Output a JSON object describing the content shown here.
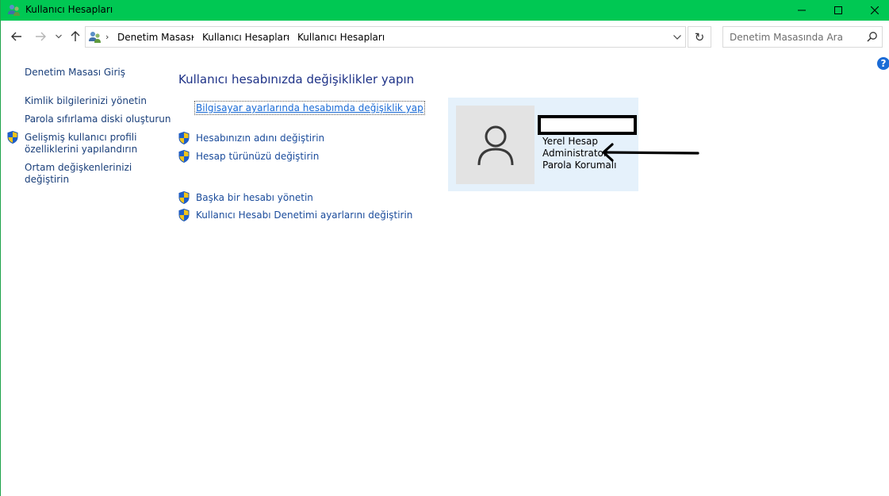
{
  "window": {
    "title": "Kullanıcı Hesapları",
    "titlebar_color": "#00c853",
    "title_icon": "user-accounts-icon"
  },
  "nav": {
    "breadcrumbs": [
      "Denetim Masası",
      "Kullanıcı Hesapları",
      "Kullanıcı Hesapları"
    ],
    "search_placeholder": "Denetim Masasında Ara"
  },
  "sidebar": {
    "items": [
      {
        "label": "Denetim Masası Giriş",
        "shield": false
      },
      {
        "label": "Kimlik bilgilerinizi yönetin",
        "shield": false
      },
      {
        "label": "Parola sıfırlama diski oluşturun",
        "shield": false
      },
      {
        "label_line1": "Gelişmiş kullanıcı profili",
        "label_line2": "özelliklerini yapılandırın",
        "shield": true
      },
      {
        "label_line1": "Ortam değişkenlerinizi",
        "label_line2": "değiştirin",
        "shield": false
      }
    ]
  },
  "main": {
    "title": "Kullanıcı hesabınızda değişiklikler yapın",
    "pc_settings_link": "Bilgisayar ayarlarında hesabımda değişiklik yap",
    "tasks": [
      "Hesabınızın adını değiştirin",
      "Hesap türünüzü değiştirin",
      "Başka bir hesabı yönetin",
      "Kullanıcı Hesabı Denetimi ayarlarını değiştirin"
    ]
  },
  "account": {
    "lines": [
      "Yerel Hesap",
      "Administrator",
      "Parola Korumalı"
    ],
    "avatar_icon": "user-avatar-icon",
    "card_color": "#e5f1fb"
  },
  "colors": {
    "link": "#1a4b9b",
    "heading": "#1e3287",
    "accent": "#1a6bd6"
  }
}
